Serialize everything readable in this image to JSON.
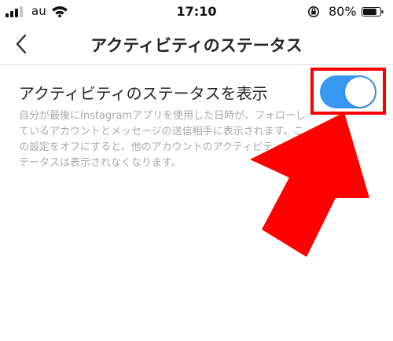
{
  "status_bar": {
    "carrier": "au",
    "time": "17:10",
    "battery_percent": "80%",
    "battery_level": 0.8
  },
  "nav": {
    "title": "アクティビティのステータス"
  },
  "setting": {
    "label": "アクティビティのステータスを表示",
    "description": "自分が最後にInstagramアプリを使用した日時が、フォローしているアカウントとメッセージの送信相手に表示されます。この設定をオフにすると、他のアカウントのアクティビティのステータスは表示されなくなります。",
    "toggle_on": true
  },
  "colors": {
    "toggle_on": "#3897f0",
    "annotation": "#ff0000",
    "description_text": "#a8a8a8"
  },
  "icons": {
    "back": "chevron-left-icon",
    "wifi": "wifi-icon",
    "rotation_lock": "rotation-lock-icon",
    "battery": "battery-icon",
    "signal": "signal-icon"
  }
}
